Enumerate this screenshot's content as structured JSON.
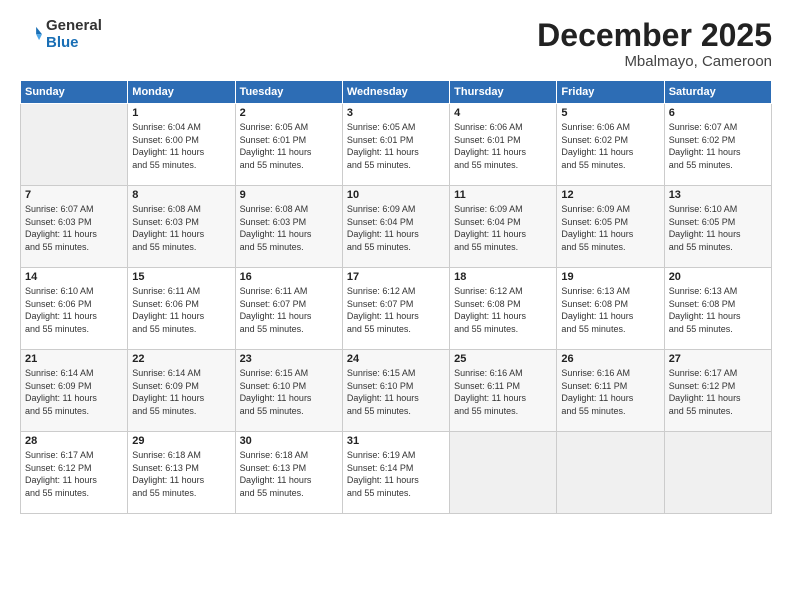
{
  "logo": {
    "general": "General",
    "blue": "Blue"
  },
  "title": "December 2025",
  "location": "Mbalmayo, Cameroon",
  "headers": [
    "Sunday",
    "Monday",
    "Tuesday",
    "Wednesday",
    "Thursday",
    "Friday",
    "Saturday"
  ],
  "weeks": [
    [
      {
        "day": "",
        "detail": ""
      },
      {
        "day": "1",
        "detail": "Sunrise: 6:04 AM\nSunset: 6:00 PM\nDaylight: 11 hours\nand 55 minutes."
      },
      {
        "day": "2",
        "detail": "Sunrise: 6:05 AM\nSunset: 6:01 PM\nDaylight: 11 hours\nand 55 minutes."
      },
      {
        "day": "3",
        "detail": "Sunrise: 6:05 AM\nSunset: 6:01 PM\nDaylight: 11 hours\nand 55 minutes."
      },
      {
        "day": "4",
        "detail": "Sunrise: 6:06 AM\nSunset: 6:01 PM\nDaylight: 11 hours\nand 55 minutes."
      },
      {
        "day": "5",
        "detail": "Sunrise: 6:06 AM\nSunset: 6:02 PM\nDaylight: 11 hours\nand 55 minutes."
      },
      {
        "day": "6",
        "detail": "Sunrise: 6:07 AM\nSunset: 6:02 PM\nDaylight: 11 hours\nand 55 minutes."
      }
    ],
    [
      {
        "day": "7",
        "detail": "Sunrise: 6:07 AM\nSunset: 6:03 PM\nDaylight: 11 hours\nand 55 minutes."
      },
      {
        "day": "8",
        "detail": "Sunrise: 6:08 AM\nSunset: 6:03 PM\nDaylight: 11 hours\nand 55 minutes."
      },
      {
        "day": "9",
        "detail": "Sunrise: 6:08 AM\nSunset: 6:03 PM\nDaylight: 11 hours\nand 55 minutes."
      },
      {
        "day": "10",
        "detail": "Sunrise: 6:09 AM\nSunset: 6:04 PM\nDaylight: 11 hours\nand 55 minutes."
      },
      {
        "day": "11",
        "detail": "Sunrise: 6:09 AM\nSunset: 6:04 PM\nDaylight: 11 hours\nand 55 minutes."
      },
      {
        "day": "12",
        "detail": "Sunrise: 6:09 AM\nSunset: 6:05 PM\nDaylight: 11 hours\nand 55 minutes."
      },
      {
        "day": "13",
        "detail": "Sunrise: 6:10 AM\nSunset: 6:05 PM\nDaylight: 11 hours\nand 55 minutes."
      }
    ],
    [
      {
        "day": "14",
        "detail": "Sunrise: 6:10 AM\nSunset: 6:06 PM\nDaylight: 11 hours\nand 55 minutes."
      },
      {
        "day": "15",
        "detail": "Sunrise: 6:11 AM\nSunset: 6:06 PM\nDaylight: 11 hours\nand 55 minutes."
      },
      {
        "day": "16",
        "detail": "Sunrise: 6:11 AM\nSunset: 6:07 PM\nDaylight: 11 hours\nand 55 minutes."
      },
      {
        "day": "17",
        "detail": "Sunrise: 6:12 AM\nSunset: 6:07 PM\nDaylight: 11 hours\nand 55 minutes."
      },
      {
        "day": "18",
        "detail": "Sunrise: 6:12 AM\nSunset: 6:08 PM\nDaylight: 11 hours\nand 55 minutes."
      },
      {
        "day": "19",
        "detail": "Sunrise: 6:13 AM\nSunset: 6:08 PM\nDaylight: 11 hours\nand 55 minutes."
      },
      {
        "day": "20",
        "detail": "Sunrise: 6:13 AM\nSunset: 6:08 PM\nDaylight: 11 hours\nand 55 minutes."
      }
    ],
    [
      {
        "day": "21",
        "detail": "Sunrise: 6:14 AM\nSunset: 6:09 PM\nDaylight: 11 hours\nand 55 minutes."
      },
      {
        "day": "22",
        "detail": "Sunrise: 6:14 AM\nSunset: 6:09 PM\nDaylight: 11 hours\nand 55 minutes."
      },
      {
        "day": "23",
        "detail": "Sunrise: 6:15 AM\nSunset: 6:10 PM\nDaylight: 11 hours\nand 55 minutes."
      },
      {
        "day": "24",
        "detail": "Sunrise: 6:15 AM\nSunset: 6:10 PM\nDaylight: 11 hours\nand 55 minutes."
      },
      {
        "day": "25",
        "detail": "Sunrise: 6:16 AM\nSunset: 6:11 PM\nDaylight: 11 hours\nand 55 minutes."
      },
      {
        "day": "26",
        "detail": "Sunrise: 6:16 AM\nSunset: 6:11 PM\nDaylight: 11 hours\nand 55 minutes."
      },
      {
        "day": "27",
        "detail": "Sunrise: 6:17 AM\nSunset: 6:12 PM\nDaylight: 11 hours\nand 55 minutes."
      }
    ],
    [
      {
        "day": "28",
        "detail": "Sunrise: 6:17 AM\nSunset: 6:12 PM\nDaylight: 11 hours\nand 55 minutes."
      },
      {
        "day": "29",
        "detail": "Sunrise: 6:18 AM\nSunset: 6:13 PM\nDaylight: 11 hours\nand 55 minutes."
      },
      {
        "day": "30",
        "detail": "Sunrise: 6:18 AM\nSunset: 6:13 PM\nDaylight: 11 hours\nand 55 minutes."
      },
      {
        "day": "31",
        "detail": "Sunrise: 6:19 AM\nSunset: 6:14 PM\nDaylight: 11 hours\nand 55 minutes."
      },
      {
        "day": "",
        "detail": ""
      },
      {
        "day": "",
        "detail": ""
      },
      {
        "day": "",
        "detail": ""
      }
    ]
  ]
}
